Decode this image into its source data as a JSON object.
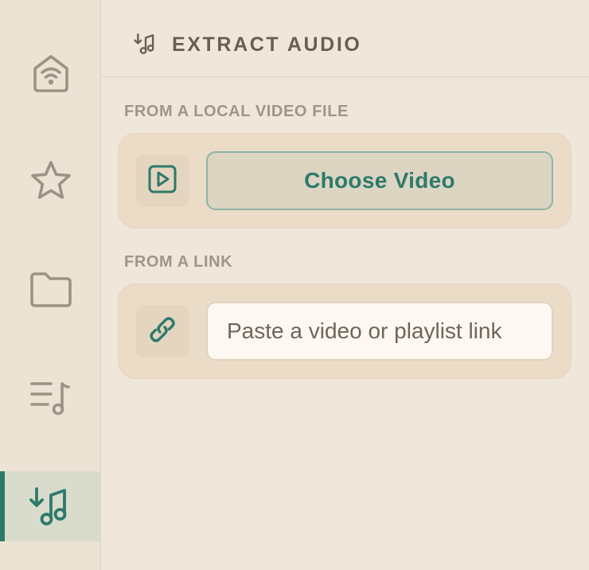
{
  "sidebar": {
    "items": [
      {
        "icon": "home-wifi-icon",
        "name": "home"
      },
      {
        "icon": "star-icon",
        "name": "favorites"
      },
      {
        "icon": "folder-icon",
        "name": "files"
      },
      {
        "icon": "playlist-icon",
        "name": "playlist"
      },
      {
        "icon": "extract-audio-icon",
        "name": "extract-audio",
        "active": true
      }
    ]
  },
  "header": {
    "icon": "extract-audio-icon",
    "title": "EXTRACT AUDIO"
  },
  "local_section": {
    "label": "FROM A LOCAL VIDEO FILE",
    "icon": "video-file-icon",
    "button_label": "Choose Video"
  },
  "link_section": {
    "label": "FROM A LINK",
    "icon": "link-icon",
    "input_value": "",
    "placeholder": "Paste a video or playlist link"
  },
  "colors": {
    "accent": "#2d7a6a",
    "background": "#f0e7da",
    "sidebar": "#ece3d5",
    "muted_text": "#a0958a",
    "card": "#ebdcc7"
  }
}
